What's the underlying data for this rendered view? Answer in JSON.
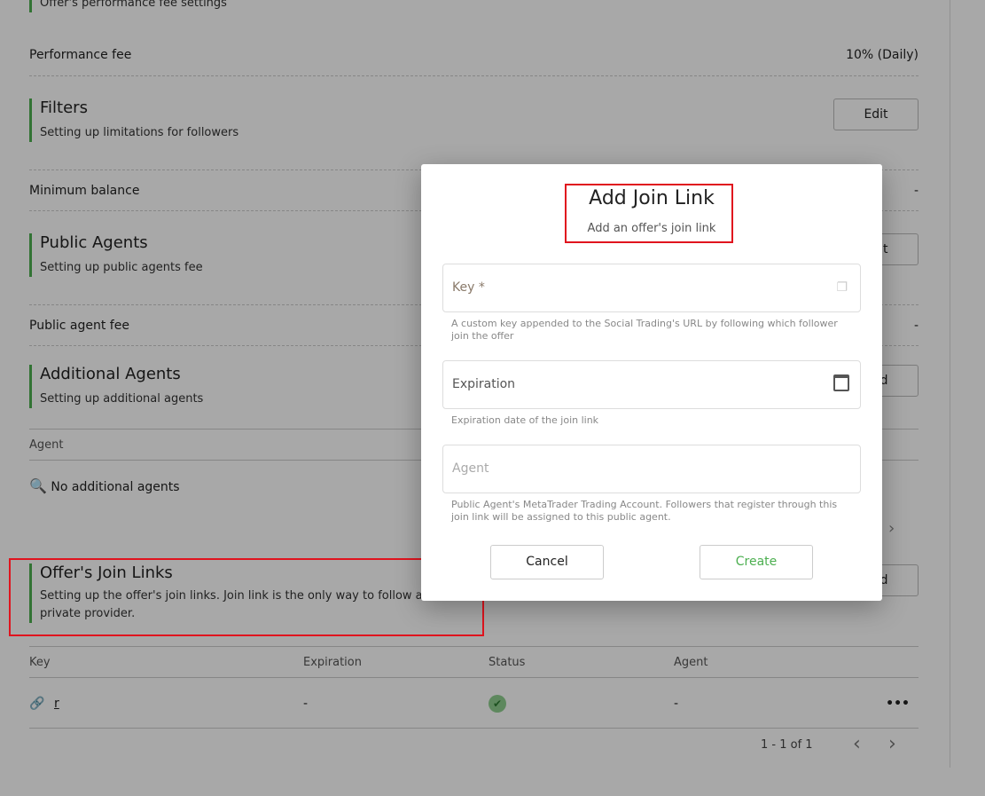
{
  "sections": {
    "perf_sub": "Offer's performance fee settings",
    "perf_label": "Performance fee",
    "perf_value": "10% (Daily)",
    "filters_title": "Filters",
    "filters_sub": "Setting up limitations for followers",
    "filters_btn": "Edit",
    "min_label": "Minimum balance",
    "min_value": "-",
    "public_title": "Public Agents",
    "public_sub": "Setting up public agents fee",
    "public_btn": "Edit",
    "public_label": "Public agent fee",
    "public_value": "-",
    "add_title": "Additional Agents",
    "add_sub": "Setting up additional agents",
    "add_btn": "Add",
    "agent_header": "Agent",
    "no_agents": "No additional agents",
    "join_title": "Offer's Join Links",
    "join_sub": "Setting up the offer's join links. Join link is the only way to follow a private provider.",
    "join_btn": "Add"
  },
  "table": {
    "headers": [
      "Key",
      "Expiration",
      "Status",
      "Agent"
    ],
    "rows": [
      {
        "key": "r",
        "expiration": "-",
        "status": "active",
        "agent": "-"
      }
    ],
    "pagination": "1 - 1 of 1"
  },
  "modal": {
    "title": "Add Join Link",
    "subtitle": "Add an offer's join link",
    "key_label": "Key *",
    "key_help": "A custom key appended to the Social Trading's URL by following which follower join the offer",
    "exp_label": "Expiration",
    "exp_help": "Expiration date of the join link",
    "agent_label": "Agent",
    "agent_help": "Public Agent's MetaTrader Trading Account. Followers that register through this join link will be assigned to this public agent.",
    "cancel": "Cancel",
    "create": "Create"
  },
  "colors": {
    "accent": "#4caf50",
    "highlight": "#e0141e"
  }
}
